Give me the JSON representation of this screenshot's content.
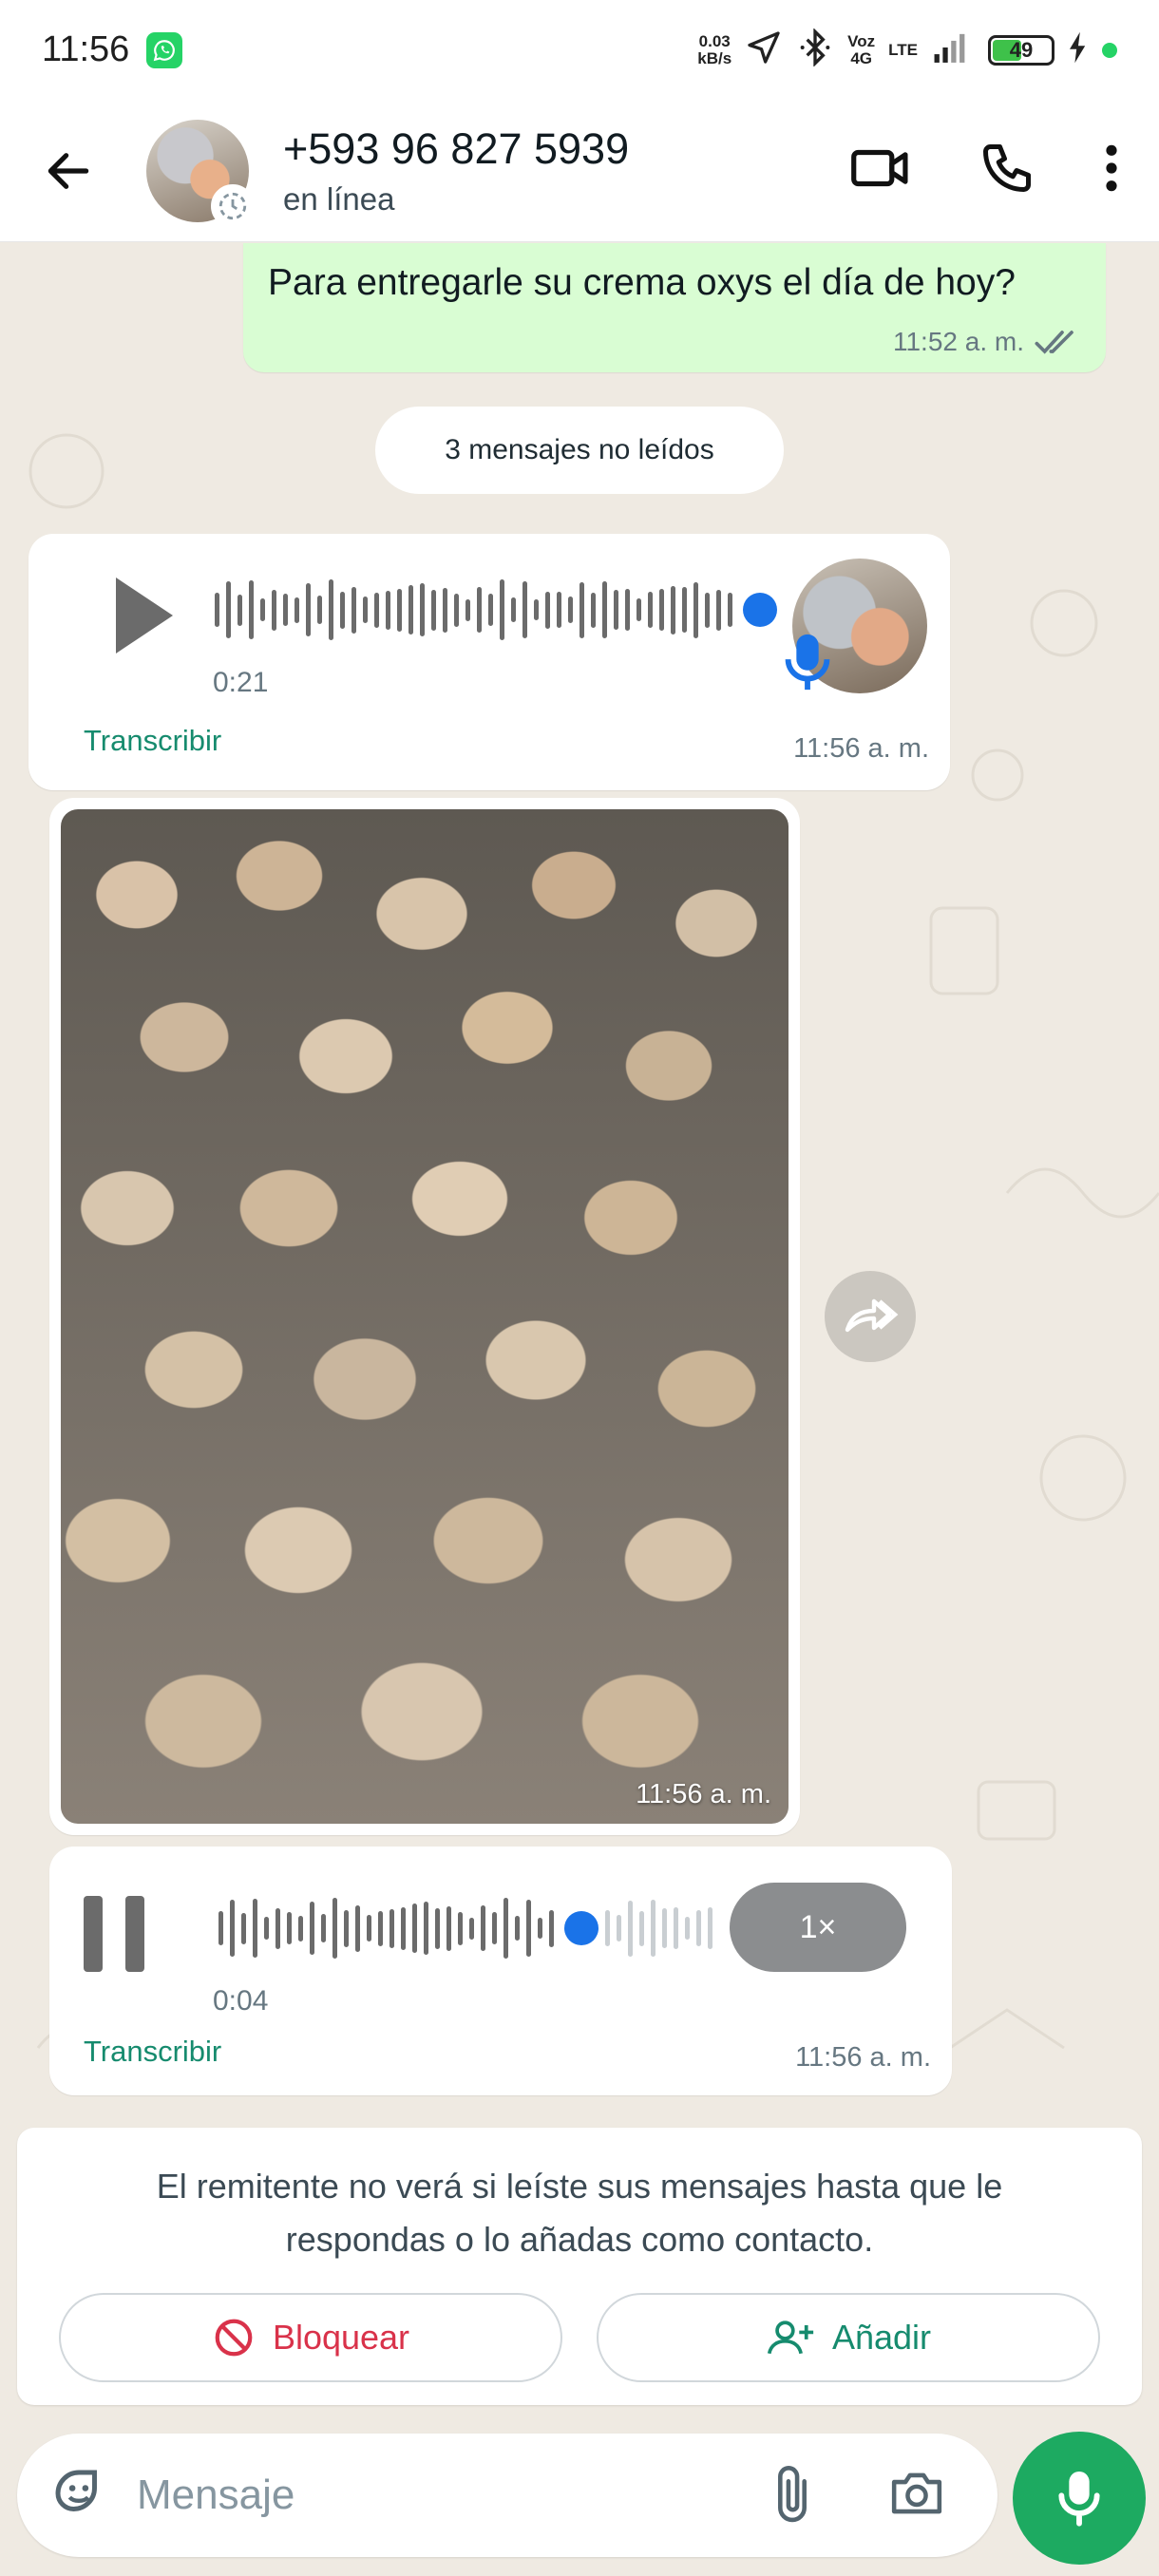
{
  "status_bar": {
    "time": "11:56",
    "net_speed_value": "0.03",
    "net_speed_unit": "kB/s",
    "volte_top": "Voz",
    "volte_bottom": "4G",
    "lte": "LTE",
    "battery_level": "49",
    "battery_fraction": 0.49
  },
  "header": {
    "contact_name": "+593 96 827 5939",
    "contact_status": "en línea"
  },
  "messages": {
    "outgoing_text": "Para entregarle su crema oxys el día de hoy?",
    "outgoing_time": "11:52 a. m.",
    "unread_label": "3 mensajes no leídos",
    "voice1_duration": "0:21",
    "voice1_transcribe": "Transcribir",
    "voice1_time": "11:56 a. m.",
    "image_time": "11:56 a. m.",
    "voice2_duration": "0:04",
    "voice2_speed": "1×",
    "voice2_transcribe": "Transcribir",
    "voice2_time": "11:56 a. m.",
    "voice2_progress": 0.75
  },
  "notice": {
    "text": "El remitente no verá si leíste sus mensajes hasta que le respondas o lo añadas como contacto.",
    "block_label": "Bloquear",
    "add_label": "Añadir"
  },
  "composer": {
    "placeholder": "Mensaje"
  },
  "colors": {
    "outgoing_bubble": "#d9fdd3",
    "accent_green": "#1daa61",
    "link_green": "#168b6e",
    "danger_red": "#d9324a",
    "progress_blue": "#1a73e8"
  },
  "icons": [
    "whatsapp-icon",
    "location-arrow-icon",
    "bluetooth-icon",
    "signal-icon",
    "battery-icon",
    "charging-icon",
    "back-arrow-icon",
    "status-ring-icon",
    "video-call-icon",
    "phone-icon",
    "more-vert-icon",
    "double-check-icon",
    "play-icon",
    "pause-icon",
    "mic-icon",
    "forward-icon",
    "block-icon",
    "add-contact-icon",
    "sticker-icon",
    "attach-icon",
    "camera-icon"
  ]
}
